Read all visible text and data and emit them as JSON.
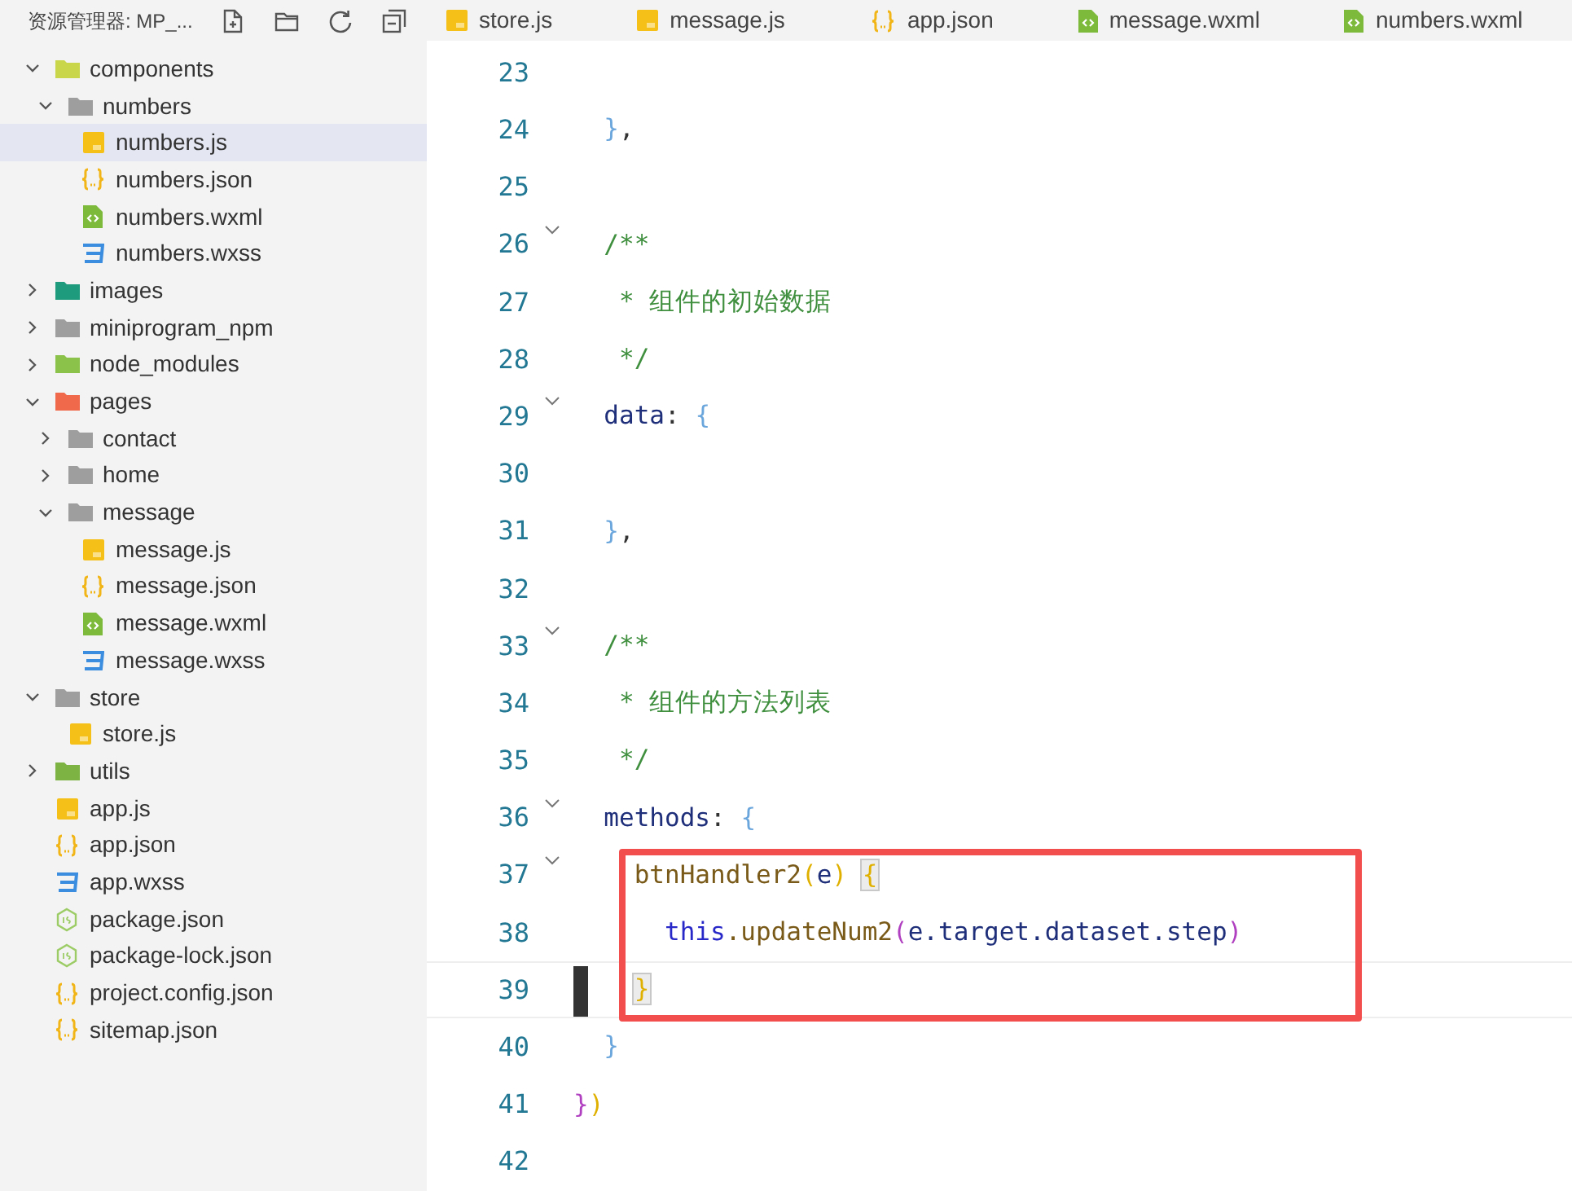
{
  "sidebar": {
    "title": "资源管理器: MP_...",
    "tree": [
      {
        "label": "components",
        "kind": "components-folder",
        "expanded": true,
        "selected": false,
        "children": [
          {
            "label": "numbers",
            "kind": "folder",
            "expanded": true,
            "selected": false,
            "children": [
              {
                "label": "numbers.js",
                "kind": "js",
                "selected": true
              },
              {
                "label": "numbers.json",
                "kind": "json",
                "selected": false
              },
              {
                "label": "numbers.wxml",
                "kind": "wxml",
                "selected": false
              },
              {
                "label": "numbers.wxss",
                "kind": "wxss",
                "selected": false
              }
            ]
          }
        ]
      },
      {
        "label": "images",
        "kind": "images-folder",
        "expanded": false,
        "selected": false
      },
      {
        "label": "miniprogram_npm",
        "kind": "folder",
        "expanded": false,
        "selected": false
      },
      {
        "label": "node_modules",
        "kind": "modules-folder",
        "expanded": false,
        "selected": false
      },
      {
        "label": "pages",
        "kind": "pages-folder",
        "expanded": true,
        "selected": false,
        "children": [
          {
            "label": "contact",
            "kind": "folder",
            "expanded": false,
            "selected": false
          },
          {
            "label": "home",
            "kind": "folder",
            "expanded": false,
            "selected": false
          },
          {
            "label": "message",
            "kind": "folder",
            "expanded": true,
            "selected": false,
            "children": [
              {
                "label": "message.js",
                "kind": "js",
                "selected": false
              },
              {
                "label": "message.json",
                "kind": "json",
                "selected": false
              },
              {
                "label": "message.wxml",
                "kind": "wxml",
                "selected": false
              },
              {
                "label": "message.wxss",
                "kind": "wxss",
                "selected": false
              }
            ]
          }
        ]
      },
      {
        "label": "store",
        "kind": "folder",
        "expanded": true,
        "selected": false,
        "children": [
          {
            "label": "store.js",
            "kind": "js",
            "selected": false
          }
        ]
      },
      {
        "label": "utils",
        "kind": "utils-folder",
        "expanded": false,
        "selected": false
      },
      {
        "label": "app.js",
        "kind": "js",
        "selected": false
      },
      {
        "label": "app.json",
        "kind": "json",
        "selected": false
      },
      {
        "label": "app.wxss",
        "kind": "wxss",
        "selected": false
      },
      {
        "label": "package.json",
        "kind": "node",
        "selected": false
      },
      {
        "label": "package-lock.json",
        "kind": "node",
        "selected": false
      },
      {
        "label": "project.config.json",
        "kind": "json",
        "selected": false
      },
      {
        "label": "sitemap.json",
        "kind": "json",
        "selected": false
      }
    ]
  },
  "tabs": [
    {
      "label": "store.js",
      "kind": "js"
    },
    {
      "label": "message.js",
      "kind": "js"
    },
    {
      "label": "app.json",
      "kind": "json"
    },
    {
      "label": "message.wxml",
      "kind": "wxml"
    },
    {
      "label": "numbers.wxml",
      "kind": "wxml"
    }
  ],
  "code": {
    "lines": [
      {
        "number": "23",
        "foldable": false,
        "highlighted": false,
        "cursor": false
      },
      {
        "number": "24",
        "foldable": false,
        "highlighted": false,
        "cursor": false,
        "tokens": [
          {
            "text": "  }",
            "kind": "brace1",
            "matched": false
          },
          {
            "text": ",",
            "kind": "punct",
            "matched": false
          }
        ]
      },
      {
        "number": "25",
        "foldable": false,
        "highlighted": false,
        "cursor": false
      },
      {
        "number": "26",
        "foldable": true,
        "highlighted": false,
        "cursor": false,
        "tokens": [
          {
            "text": "  /**",
            "kind": "comment",
            "matched": false
          }
        ]
      },
      {
        "number": "27",
        "foldable": false,
        "highlighted": false,
        "cursor": false,
        "tokens": [
          {
            "text": "   * 组件的初始数据",
            "kind": "comment",
            "matched": false
          }
        ]
      },
      {
        "number": "28",
        "foldable": false,
        "highlighted": false,
        "cursor": false,
        "tokens": [
          {
            "text": "   */",
            "kind": "comment",
            "matched": false
          }
        ]
      },
      {
        "number": "29",
        "foldable": true,
        "highlighted": false,
        "cursor": false,
        "tokens": [
          {
            "text": "  data",
            "kind": "prop",
            "matched": false
          },
          {
            "text": ":",
            "kind": "punct",
            "matched": false
          },
          {
            "text": "{",
            "kind": "brace1",
            "matched": false
          }
        ]
      },
      {
        "number": "30",
        "foldable": false,
        "highlighted": false,
        "cursor": false
      },
      {
        "number": "31",
        "foldable": false,
        "highlighted": false,
        "cursor": false,
        "tokens": [
          {
            "text": "  }",
            "kind": "brace1",
            "matched": false
          },
          {
            "text": ",",
            "kind": "punct",
            "matched": false
          }
        ]
      },
      {
        "number": "32",
        "foldable": false,
        "highlighted": false,
        "cursor": false
      },
      {
        "number": "33",
        "foldable": true,
        "highlighted": false,
        "cursor": false,
        "tokens": [
          {
            "text": "  /**",
            "kind": "comment",
            "matched": false
          }
        ]
      },
      {
        "number": "34",
        "foldable": false,
        "highlighted": false,
        "cursor": false,
        "tokens": [
          {
            "text": "   * 组件的方法列表",
            "kind": "comment",
            "matched": false
          }
        ]
      },
      {
        "number": "35",
        "foldable": false,
        "highlighted": false,
        "cursor": false,
        "tokens": [
          {
            "text": "   */",
            "kind": "comment",
            "matched": false
          }
        ]
      },
      {
        "number": "36",
        "foldable": true,
        "highlighted": false,
        "cursor": false,
        "tokens": [
          {
            "text": "  methods",
            "kind": "prop",
            "matched": false
          },
          {
            "text": ":",
            "kind": "punct",
            "matched": false
          },
          {
            "text": "{",
            "kind": "brace1",
            "matched": false
          }
        ]
      },
      {
        "number": "37",
        "foldable": true,
        "highlighted": true,
        "cursor": false,
        "tokens": [
          {
            "text": "    btnHandler2",
            "kind": "func",
            "matched": false
          },
          {
            "text": "(",
            "kind": "brace2",
            "matched": false
          },
          {
            "text": "e",
            "kind": "prop",
            "matched": false
          },
          {
            "text": ")",
            "kind": "brace2",
            "matched": false
          },
          {
            "text": "{",
            "kind": "brace2",
            "matched": true
          }
        ]
      },
      {
        "number": "38",
        "foldable": false,
        "highlighted": true,
        "cursor": false,
        "tokens": [
          {
            "text": "      this",
            "kind": "keyword",
            "matched": false
          },
          {
            "text": ".updateNum2",
            "kind": "func",
            "matched": false
          },
          {
            "text": "(",
            "kind": "brace3",
            "matched": false
          },
          {
            "text": "e.target.dataset.step",
            "kind": "prop",
            "matched": false
          },
          {
            "text": ")",
            "kind": "brace3",
            "matched": false
          }
        ]
      },
      {
        "number": "39",
        "foldable": false,
        "highlighted": true,
        "cursor": true,
        "tokens": [
          {
            "text": "    }",
            "kind": "brace2",
            "matched": true
          }
        ]
      },
      {
        "number": "40",
        "foldable": false,
        "highlighted": false,
        "cursor": false,
        "tokens": [
          {
            "text": "  }",
            "kind": "brace1",
            "matched": false
          }
        ]
      },
      {
        "number": "41",
        "foldable": false,
        "highlighted": false,
        "cursor": false,
        "tokens": [
          {
            "text": "}",
            "kind": "brace3",
            "matched": false
          },
          {
            "text": ")",
            "kind": "brace2",
            "matched": false
          }
        ]
      },
      {
        "number": "42",
        "foldable": false,
        "highlighted": false,
        "cursor": false
      }
    ]
  }
}
